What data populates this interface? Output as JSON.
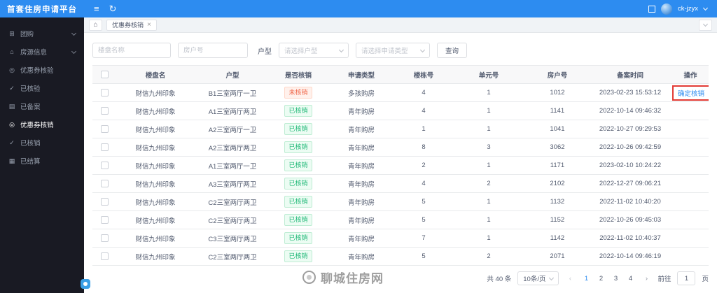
{
  "colors": {
    "primary": "#2d8cf0",
    "sidebar_bg": "#191a23",
    "tag_unverified_text": "#f0674a",
    "tag_verified_text": "#21b978",
    "highlight_box": "#e23b35"
  },
  "header": {
    "title": "首套住房申请平台",
    "username": "ck-jzyx"
  },
  "sidebar": {
    "items": [
      {
        "key": "group-buy",
        "label": "团购",
        "icon": "group-buy-icon",
        "glyph": "⊞",
        "chevron": true,
        "active": false
      },
      {
        "key": "housing-info",
        "label": "房源信息",
        "icon": "housing-info-icon",
        "glyph": "⌂",
        "chevron": true,
        "active": false
      },
      {
        "key": "coupon-verify",
        "label": "优惠券核验",
        "icon": "coupon-verify-icon",
        "glyph": "◎",
        "chevron": false,
        "active": false
      },
      {
        "key": "verified",
        "label": "已核验",
        "icon": "verified-icon",
        "glyph": "✓",
        "chevron": false,
        "active": false
      },
      {
        "key": "filed",
        "label": "已备案",
        "icon": "filed-icon",
        "glyph": "▤",
        "chevron": false,
        "active": false
      },
      {
        "key": "coupon-redeem",
        "label": "优惠券核销",
        "icon": "coupon-redeem-icon",
        "glyph": "◎",
        "chevron": false,
        "active": true
      },
      {
        "key": "redeemed",
        "label": "已核销",
        "icon": "redeemed-icon",
        "glyph": "✓",
        "chevron": false,
        "active": false
      },
      {
        "key": "settled",
        "label": "已结算",
        "icon": "settled-icon",
        "glyph": "▦",
        "chevron": false,
        "active": false
      }
    ]
  },
  "tabbar": {
    "active_tab": "优惠券核销"
  },
  "filters": {
    "name_placeholder": "楼盘名称",
    "room_placeholder": "房户号",
    "unit_type_label": "户型",
    "unit_type_placeholder": "请选择户型",
    "apply_type_placeholder": "请选择申请类型",
    "search_button": "查询"
  },
  "table": {
    "columns": [
      "楼盘名",
      "户型",
      "是否核销",
      "申请类型",
      "楼栋号",
      "单元号",
      "房户号",
      "备案时间",
      "操作"
    ],
    "status_unverified": "未核销",
    "rows": [
      {
        "name": "财信九州印象",
        "unit_type": "B1三室两厅一卫",
        "status": "未核销",
        "apply_type": "多孩购房",
        "building": "4",
        "unit": "1",
        "room": "1012",
        "time": "2023-02-23 15:53:12",
        "action": "确定核销",
        "action_highlight": true
      },
      {
        "name": "财信九州印象",
        "unit_type": "A1三室两厅两卫",
        "status": "已核销",
        "apply_type": "青年购房",
        "building": "4",
        "unit": "1",
        "room": "1141",
        "time": "2022-10-14 09:46:32",
        "action": "",
        "action_highlight": false
      },
      {
        "name": "财信九州印象",
        "unit_type": "A2三室两厅一卫",
        "status": "已核销",
        "apply_type": "青年购房",
        "building": "1",
        "unit": "1",
        "room": "1041",
        "time": "2022-10-27 09:29:53",
        "action": "",
        "action_highlight": false
      },
      {
        "name": "财信九州印象",
        "unit_type": "A2三室两厅两卫",
        "status": "已核销",
        "apply_type": "青年购房",
        "building": "8",
        "unit": "3",
        "room": "3062",
        "time": "2022-10-26 09:42:59",
        "action": "",
        "action_highlight": false
      },
      {
        "name": "财信九州印象",
        "unit_type": "A1三室两厅一卫",
        "status": "已核销",
        "apply_type": "青年购房",
        "building": "2",
        "unit": "1",
        "room": "1171",
        "time": "2023-02-10 10:24:22",
        "action": "",
        "action_highlight": false
      },
      {
        "name": "财信九州印象",
        "unit_type": "A3三室两厅两卫",
        "status": "已核销",
        "apply_type": "青年购房",
        "building": "4",
        "unit": "2",
        "room": "2102",
        "time": "2022-12-27 09:06:21",
        "action": "",
        "action_highlight": false
      },
      {
        "name": "财信九州印象",
        "unit_type": "C2三室两厅两卫",
        "status": "已核销",
        "apply_type": "青年购房",
        "building": "5",
        "unit": "1",
        "room": "1132",
        "time": "2022-11-02 10:40:20",
        "action": "",
        "action_highlight": false
      },
      {
        "name": "财信九州印象",
        "unit_type": "C2三室两厅两卫",
        "status": "已核销",
        "apply_type": "青年购房",
        "building": "5",
        "unit": "1",
        "room": "1152",
        "time": "2022-10-26 09:45:03",
        "action": "",
        "action_highlight": false
      },
      {
        "name": "财信九州印象",
        "unit_type": "C3三室两厅两卫",
        "status": "已核销",
        "apply_type": "青年购房",
        "building": "7",
        "unit": "1",
        "room": "1142",
        "time": "2022-11-02 10:40:37",
        "action": "",
        "action_highlight": false
      },
      {
        "name": "财信九州印象",
        "unit_type": "C2三室两厅两卫",
        "status": "已核销",
        "apply_type": "青年购房",
        "building": "5",
        "unit": "2",
        "room": "2071",
        "time": "2022-10-14 09:46:19",
        "action": "",
        "action_highlight": false
      }
    ]
  },
  "pagination": {
    "total_label": "共 40 条",
    "page_size_label": "10条/页",
    "pages": [
      "1",
      "2",
      "3",
      "4"
    ],
    "active_page": "1",
    "prev_icon": "‹",
    "next_icon": "›",
    "goto_label": "前往",
    "goto_value": "1",
    "goto_suffix": "页"
  },
  "watermark": {
    "text": "聊城住房网"
  }
}
